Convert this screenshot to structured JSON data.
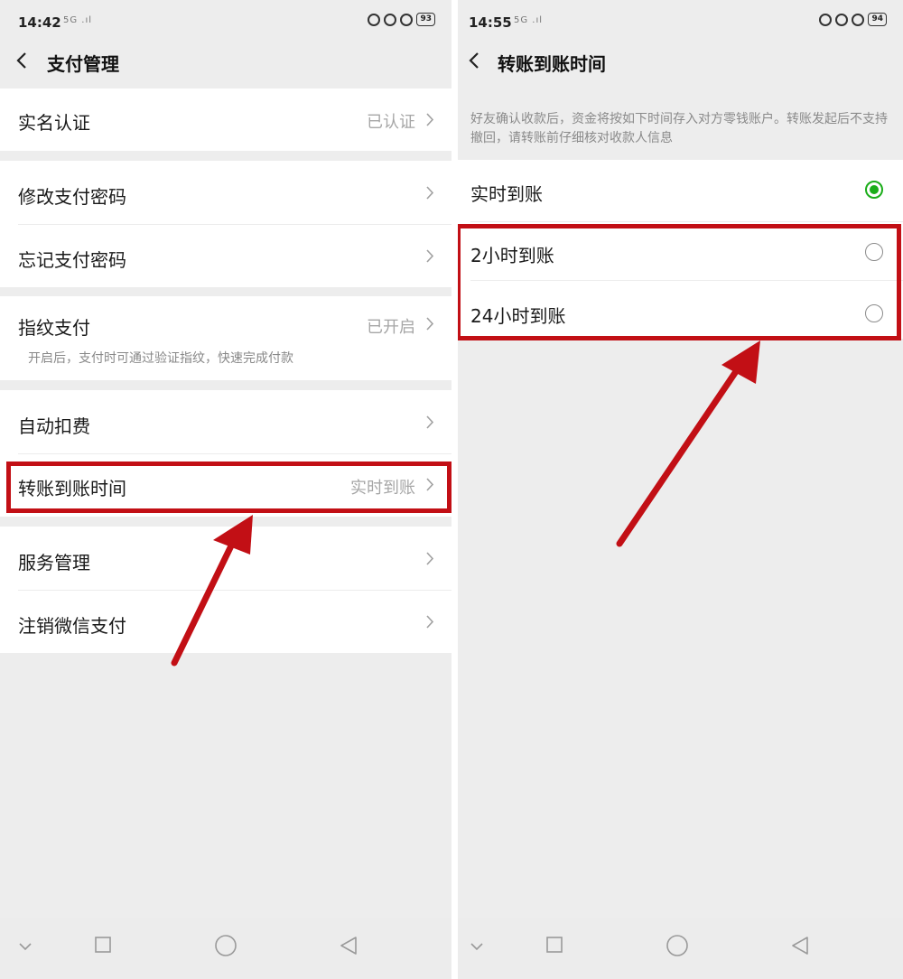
{
  "left_screen": {
    "status_time": "14:42",
    "status_signal": "5G .ıl",
    "battery": "93",
    "title": "支付管理",
    "real_name": {
      "label": "实名认证",
      "value": "已认证"
    },
    "change_password": {
      "label": "修改支付密码"
    },
    "forgot_password": {
      "label": "忘记支付密码"
    },
    "fingerprint": {
      "label": "指纹支付",
      "value": "已开启",
      "description": "开启后，支付时可通过验证指纹，快速完成付款"
    },
    "auto_deduct": {
      "label": "自动扣费"
    },
    "transfer_time": {
      "label": "转账到账时间",
      "value": "实时到账"
    },
    "service_manage": {
      "label": "服务管理"
    },
    "cancel_wechat_pay": {
      "label": "注销微信支付"
    }
  },
  "right_screen": {
    "status_time": "14:55",
    "status_signal": "5G .ıl",
    "battery": "94",
    "title": "转账到账时间",
    "hint": "好友确认收款后，资金将按如下时间存入对方零钱账户。转账发起后不支持撤回，请转账前仔细核对收款人信息",
    "options": [
      {
        "label": "实时到账",
        "selected": true
      },
      {
        "label": "2小时到账",
        "selected": false
      },
      {
        "label": "24小时到账",
        "selected": false
      }
    ]
  },
  "colors": {
    "highlight": "#c20f15",
    "accent_green": "#1aad19",
    "background": "#ededed"
  }
}
